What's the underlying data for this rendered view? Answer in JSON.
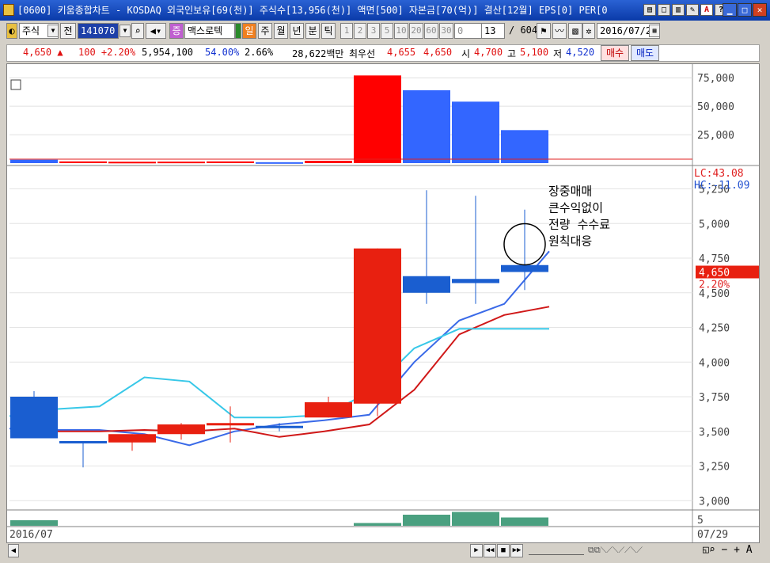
{
  "window": {
    "title": "[0600] 키움종합차트 - KOSDAQ 외국인보유[69(천)] 주식수[13,956(천)] 액면[500] 자본금[70(억)] 결산[12월] EPS[0] PER[0",
    "title_btns": [
      "▤",
      "□",
      "▥",
      "✎",
      "A",
      "?",
      "♦"
    ],
    "min": "▁",
    "max": "□",
    "close": "✕"
  },
  "toolbar": {
    "market": "주식",
    "jeon": "전",
    "code": "141070",
    "search_icon": "magnifier-icon",
    "sound_icon": "speaker-icon",
    "jeung": "증",
    "name": "맥스로텍",
    "il": "일",
    "periods": [
      "주",
      "월",
      "년",
      "분",
      "틱"
    ],
    "ticks": [
      "1",
      "2",
      "3",
      "5",
      "10",
      "20",
      "60",
      "30",
      "0"
    ],
    "count": "13",
    "total": "/ 604",
    "date": "2016/07/2"
  },
  "quote": {
    "price": "4,650 ▲",
    "change": "100 +2.20%",
    "volume": "5,954,100",
    "vol_ratio": "54.00%",
    "turnover": "2.66%",
    "amount": "28,622백만",
    "best_label": "최우선",
    "ask": "4,655",
    "bid": "4,650",
    "open_label": "시",
    "open": "4,700",
    "high_label": "고",
    "high": "5,100",
    "low_label": "저",
    "low": "4,520",
    "buy": "매수",
    "sell": "매도"
  },
  "chart_data": {
    "type": "candlestick",
    "dates_start": "2016/07",
    "dates_end": "07/29",
    "candles": [
      {
        "o": 3750,
        "h": 3790,
        "l": 3450,
        "c": 3450,
        "color": "blue"
      },
      {
        "o": 3430,
        "h": 3430,
        "l": 3240,
        "c": 3430,
        "color": "blue"
      },
      {
        "o": 3420,
        "h": 3480,
        "l": 3360,
        "c": 3480,
        "color": "red"
      },
      {
        "o": 3480,
        "h": 3560,
        "l": 3440,
        "c": 3550,
        "color": "red"
      },
      {
        "o": 3550,
        "h": 3680,
        "l": 3420,
        "c": 3560,
        "color": "red"
      },
      {
        "o": 3540,
        "h": 3560,
        "l": 3500,
        "c": 3540,
        "color": "blue"
      },
      {
        "o": 3600,
        "h": 3750,
        "l": 3600,
        "c": 3710,
        "color": "red"
      },
      {
        "o": 3700,
        "h": 4820,
        "l": 3610,
        "c": 4820,
        "color": "red"
      },
      {
        "o": 4620,
        "h": 5240,
        "l": 4420,
        "c": 4500,
        "color": "blue"
      },
      {
        "o": 4600,
        "h": 5200,
        "l": 4420,
        "c": 4570,
        "color": "blue"
      },
      {
        "o": 4700,
        "h": 5100,
        "l": 4520,
        "c": 4650,
        "color": "blue"
      }
    ],
    "ma_lines": [
      {
        "name": "ma5",
        "color": "#3a6ae8",
        "values": [
          3520,
          3510,
          3510,
          3480,
          3400,
          3500,
          3550,
          3580,
          3620,
          4000,
          4300,
          4420,
          4800
        ]
      },
      {
        "name": "ma10",
        "color": "#d01818",
        "values": [
          null,
          3500,
          3500,
          3510,
          3500,
          3520,
          3460,
          3500,
          3550,
          3800,
          4200,
          4340,
          4400
        ]
      },
      {
        "name": "ma20",
        "color": "#38c8e8",
        "values": [
          3610,
          3660,
          3680,
          3890,
          3860,
          3600,
          3600,
          3620,
          3780,
          4100,
          4240,
          4240,
          4240
        ]
      }
    ],
    "y_ticks": [
      5250,
      5000,
      4750,
      4500,
      4250,
      4000,
      3750,
      3500,
      3250,
      3000
    ],
    "y_tick_labels": [
      "5,250",
      "5,000",
      "4,750",
      "4,500",
      "4,250",
      "4,000",
      "3,750",
      "3,500",
      "3,250",
      "3,000"
    ],
    "ylim": [
      2950,
      5350
    ],
    "volume": [
      {
        "v": 3000,
        "color": "blue"
      },
      {
        "v": 1500,
        "color": "red"
      },
      {
        "v": 1200,
        "color": "red"
      },
      {
        "v": 1300,
        "color": "red"
      },
      {
        "v": 1500,
        "color": "red"
      },
      {
        "v": 800,
        "color": "blue"
      },
      {
        "v": 2000,
        "color": "red"
      },
      {
        "v": 77000,
        "color": "red"
      },
      {
        "v": 64000,
        "color": "blue"
      },
      {
        "v": 54000,
        "color": "blue"
      },
      {
        "v": 29000,
        "color": "blue"
      }
    ],
    "volume_ticks": [
      75000,
      50000,
      25000
    ],
    "volume_tick_labels": [
      "75,000",
      "50,000",
      "25,000"
    ],
    "volume_ylim": [
      0,
      80000
    ],
    "lc_label": "LC:43.08",
    "hc_label": "HC:-11.09",
    "price_tag": "4,650",
    "price_pct": "2.20%",
    "annotation": [
      "장중매매",
      "큰수익없이",
      "전량 수수료",
      "원칙대응"
    ],
    "sub_tick": "5",
    "sub_values": [
      2,
      0,
      0,
      0,
      0,
      0,
      0,
      1,
      4,
      5,
      3
    ]
  }
}
